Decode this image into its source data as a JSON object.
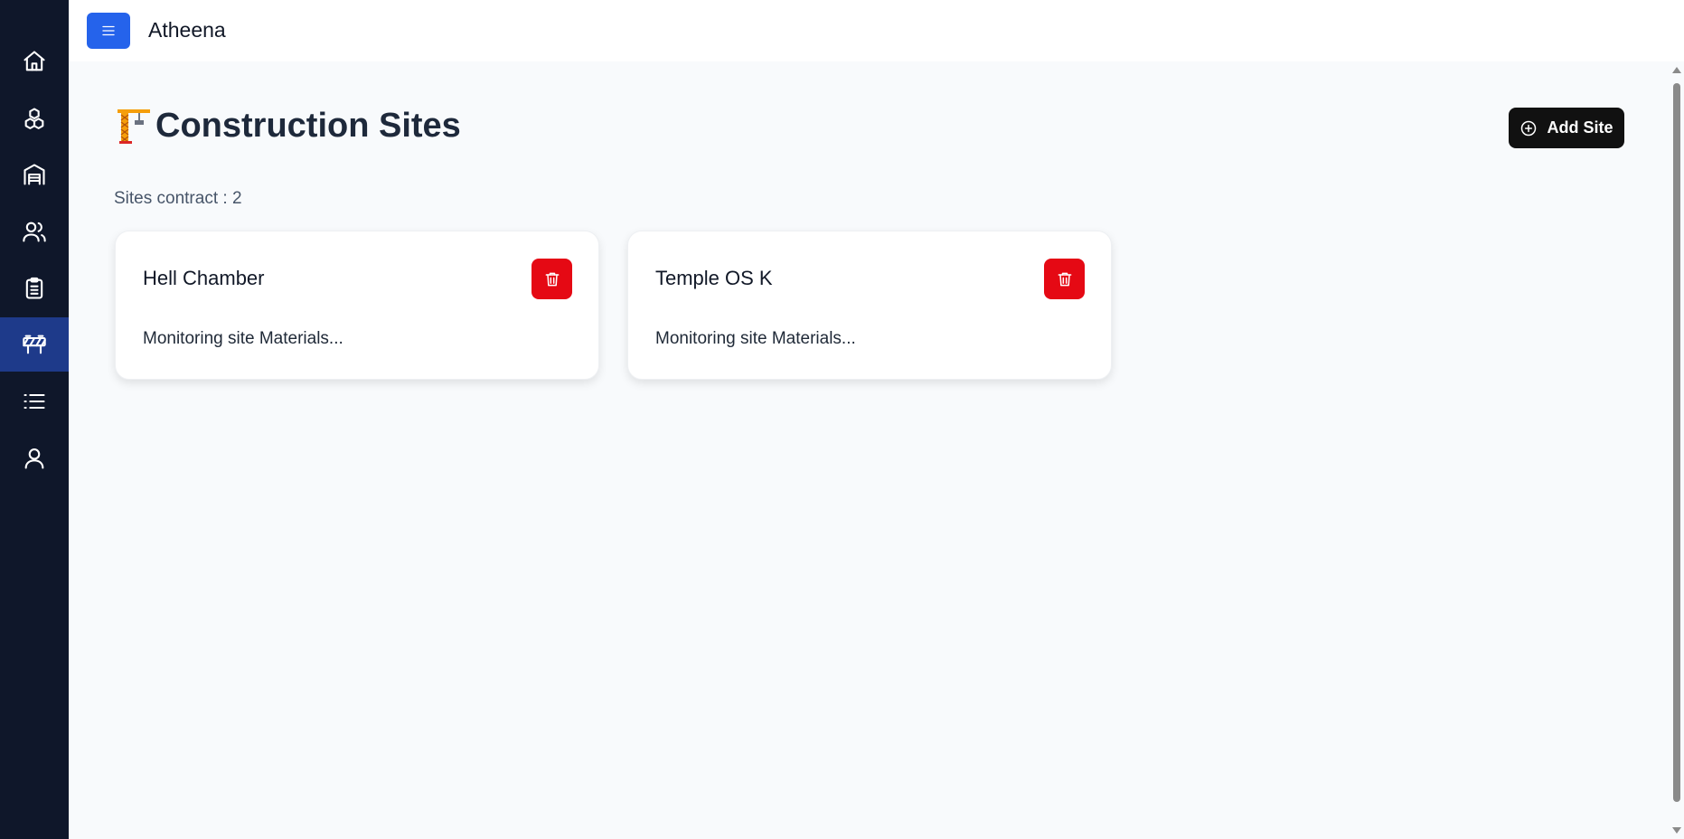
{
  "app": {
    "title": "Atheena"
  },
  "sidebar": {
    "items": [
      {
        "icon": "home-icon",
        "active": false
      },
      {
        "icon": "boxes-icon",
        "active": false
      },
      {
        "icon": "warehouse-icon",
        "active": false
      },
      {
        "icon": "users-icon",
        "active": false
      },
      {
        "icon": "clipboard-list-icon",
        "active": false
      },
      {
        "icon": "construction-barrier-icon",
        "active": true
      },
      {
        "icon": "list-icon",
        "active": false
      },
      {
        "icon": "user-icon",
        "active": false
      }
    ]
  },
  "page": {
    "emoji": "🏗️",
    "title": "Construction Sites",
    "add_button_label": "Add Site",
    "count_label": "Sites contract : 2"
  },
  "sites": [
    {
      "name": "Hell Chamber",
      "description": "Monitoring site Materials..."
    },
    {
      "name": "Temple OS K",
      "description": "Monitoring site Materials..."
    }
  ],
  "colors": {
    "sidebar_bg": "#0f172a",
    "sidebar_active": "#1e3a8a",
    "menu_button": "#2563eb",
    "delete_button": "#e50914",
    "add_button": "#111111"
  }
}
